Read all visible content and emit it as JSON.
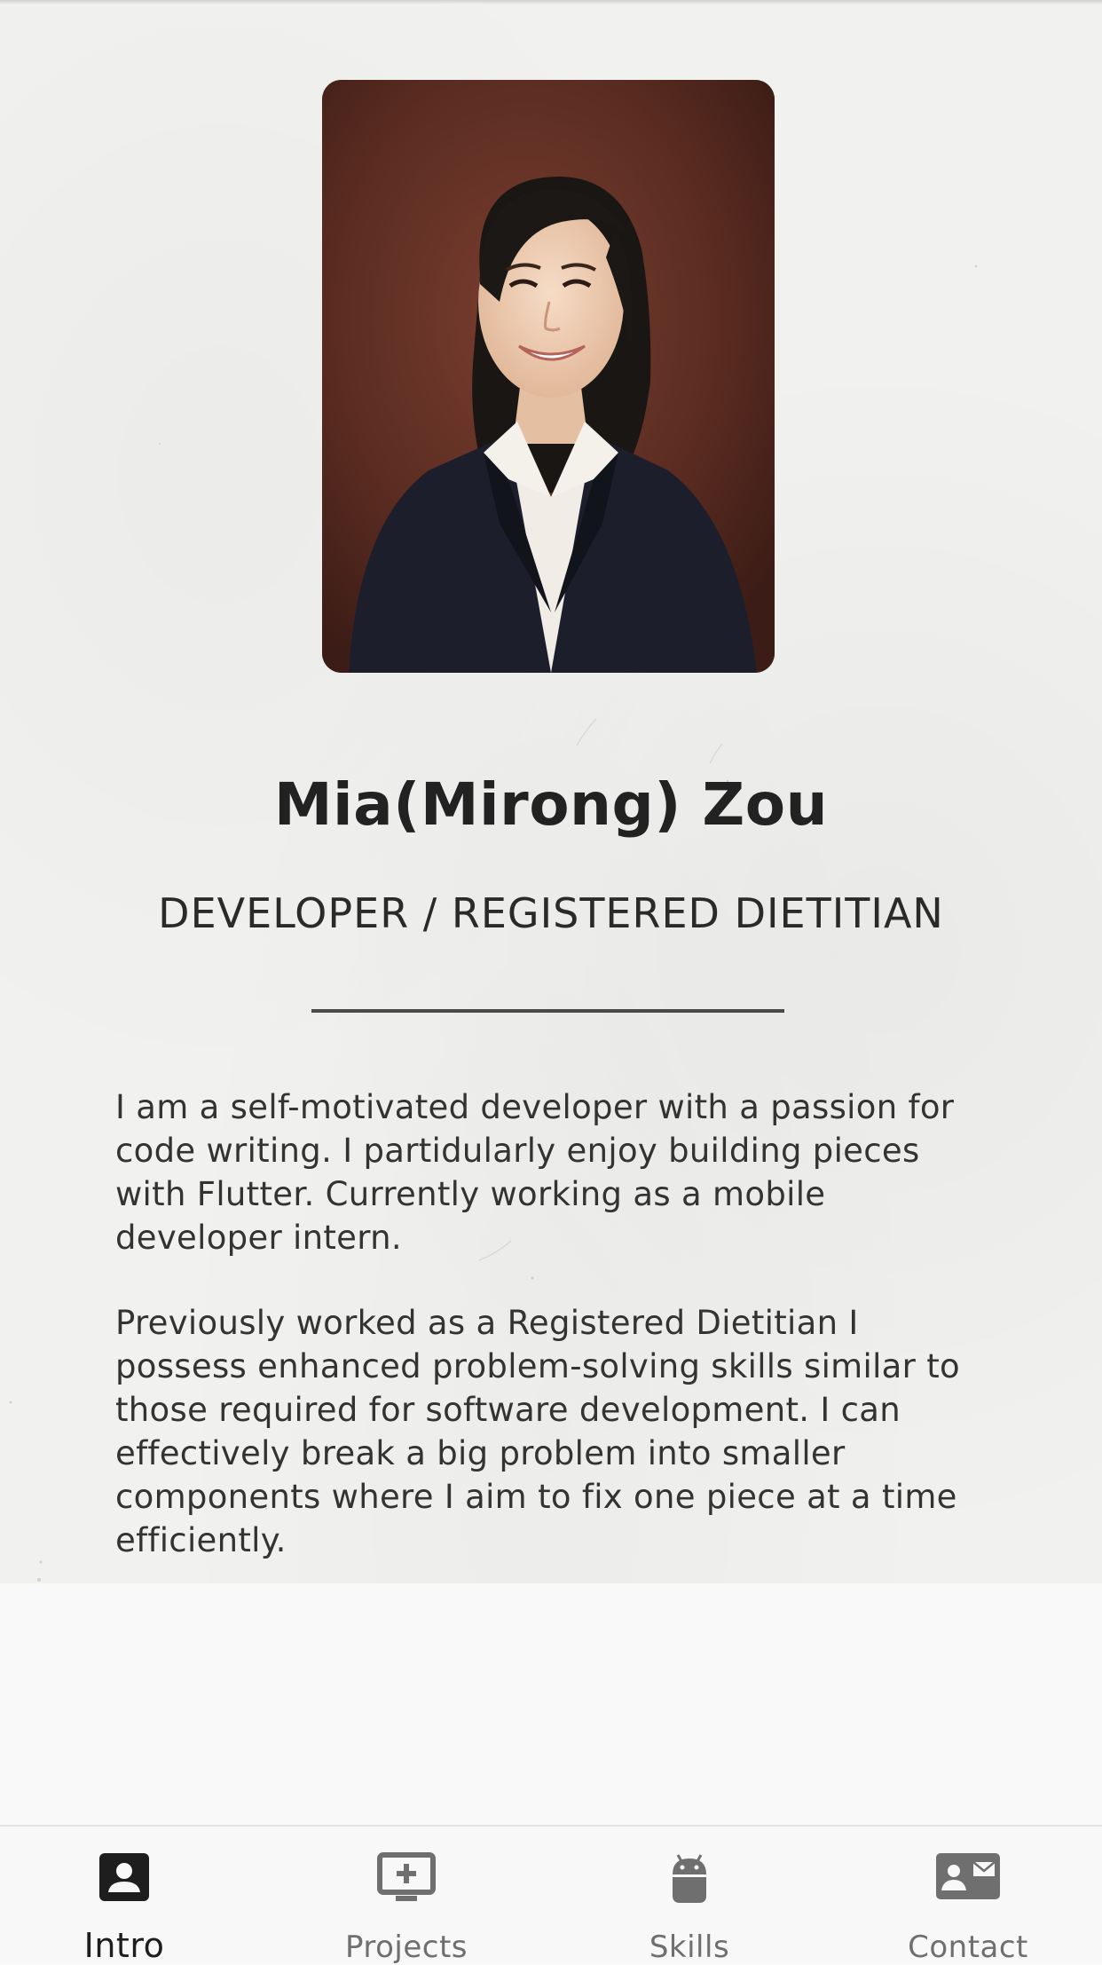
{
  "profile": {
    "name": "Mia(Mirong) Zou",
    "title": "DEVELOPER / REGISTERED DIETITIAN",
    "bio": [
      "I am a self-motivated developer with a passion for code writing. I partidularly enjoy building pieces with Flutter. Currently working as a mobile developer intern.",
      "Previously worked as a Registered Dietitian I possess enhanced problem-solving skills similar to those required for software development. I can effectively break a big problem into smaller components where I aim to fix one piece at a time efficiently."
    ]
  },
  "tabs": [
    {
      "label": "Intro",
      "icon": "person-badge-icon",
      "active": true
    },
    {
      "label": "Projects",
      "icon": "add-to-screen-icon",
      "active": false
    },
    {
      "label": "Skills",
      "icon": "android-icon",
      "active": false
    },
    {
      "label": "Contact",
      "icon": "contact-card-icon",
      "active": false
    }
  ],
  "colors": {
    "background": "#f1f1ef",
    "text": "#2b2b2b",
    "tab_active": "#1e1e1e",
    "tab_inactive": "#6f6f6f",
    "divider": "#4a4a4a"
  }
}
